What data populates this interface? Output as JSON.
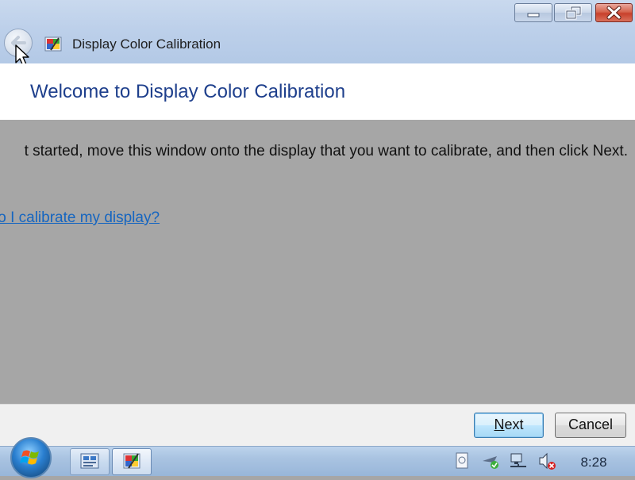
{
  "window": {
    "title": "Display Color Calibration"
  },
  "header": {
    "heading": "Welcome to Display Color Calibration"
  },
  "content": {
    "instruction": "t started, move this window onto the display that you want to calibrate, and then click Next.",
    "help_link": "lo I calibrate my display?"
  },
  "footer": {
    "next_label_accel": "N",
    "next_label_rest": "ext",
    "cancel_label": "Cancel"
  },
  "taskbar": {
    "clock": "8:28"
  },
  "icons": {
    "back": "back-arrow-icon",
    "app": "color-calibration-icon",
    "minimize": "minimize-icon",
    "maximize": "restore-icon",
    "close": "close-icon",
    "start": "windows-logo-icon",
    "tray": [
      "document-icon",
      "action-center-icon",
      "network-icon",
      "volume-muted-icon"
    ]
  },
  "colors": {
    "heading": "#1e3f8c",
    "link": "#1565c0",
    "content_bg": "#a6a6a6"
  }
}
